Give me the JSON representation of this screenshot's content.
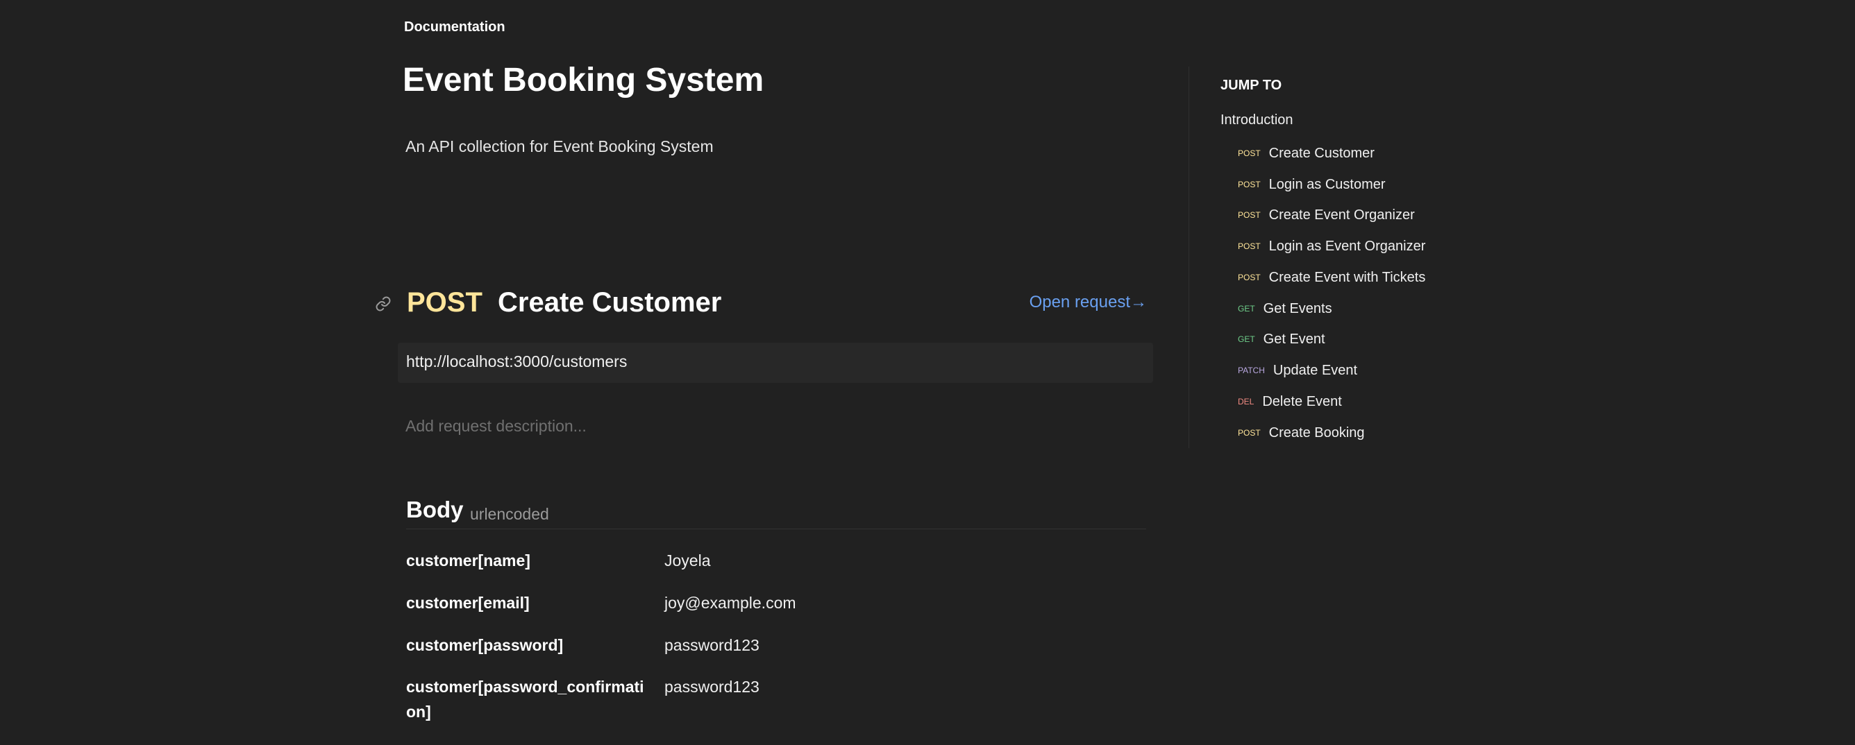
{
  "header": {
    "breadcrumb": "Documentation",
    "title": "Event Booking System",
    "description": "An API collection for Event Booking System"
  },
  "request": {
    "method": "POST",
    "name": "Create Customer",
    "open_request_label": "Open request→",
    "url": "http://localhost:3000/customers",
    "description_placeholder": "Add request description..."
  },
  "body": {
    "title": "Body",
    "mode": "urlencoded",
    "params": [
      {
        "key": "customer[name]",
        "value": "Joyela"
      },
      {
        "key": "customer[email]",
        "value": "joy@example.com"
      },
      {
        "key": "customer[password]",
        "value": "password123"
      },
      {
        "key": "customer[password_confirmation]",
        "value": "password123"
      }
    ]
  },
  "sidebar": {
    "heading": "JUMP TO",
    "intro": "Introduction",
    "items": [
      {
        "method": "POST",
        "label": "Create Customer"
      },
      {
        "method": "POST",
        "label": "Login as Customer"
      },
      {
        "method": "POST",
        "label": "Create Event Organizer"
      },
      {
        "method": "POST",
        "label": "Login as Event Organizer"
      },
      {
        "method": "POST",
        "label": "Create Event with Tickets"
      },
      {
        "method": "GET",
        "label": "Get Events"
      },
      {
        "method": "GET",
        "label": "Get Event"
      },
      {
        "method": "PATCH",
        "label": "Update Event"
      },
      {
        "method": "DEL",
        "label": "Delete Event"
      },
      {
        "method": "POST",
        "label": "Create Booking"
      }
    ]
  },
  "colors": {
    "background": "#212121",
    "post": "#ffe59a",
    "get": "#6fcf8a",
    "patch": "#b9a8e0",
    "del": "#f28b82",
    "link": "#6aa0f0"
  },
  "icons": {
    "link": "link-icon"
  }
}
